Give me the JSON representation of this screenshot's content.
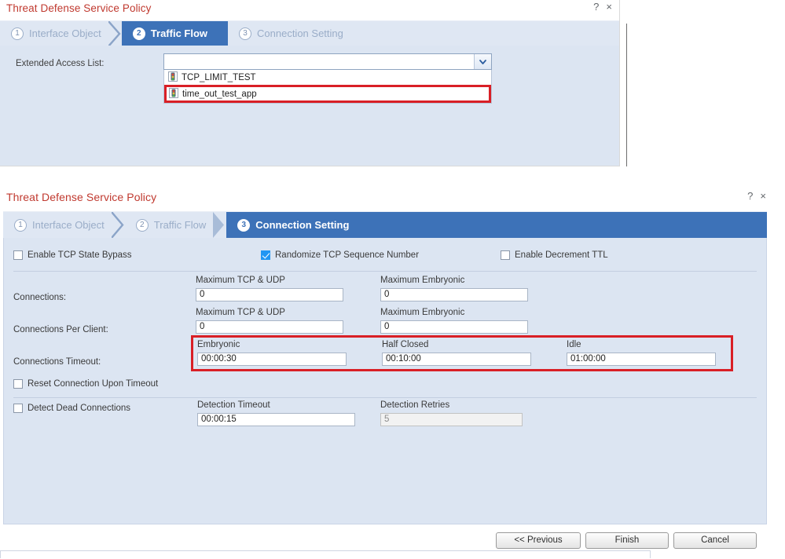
{
  "colors": {
    "title_red": "#c0392f",
    "step_active_blue": "#3d72b8",
    "step_inactive_bg": "#dfe7f3",
    "body_blue": "#dce5f2",
    "highlight_red": "#d91f26",
    "checkbox_checked_blue": "#2196f3"
  },
  "traffic_flow_dialog": {
    "title": "Threat Defense Service Policy",
    "help_icon": "question-mark-icon",
    "help_label": "?",
    "close_icon": "close-icon",
    "close_label": "×",
    "steps": [
      {
        "number": "1",
        "label": "Interface Object",
        "active": false
      },
      {
        "number": "2",
        "label": "Traffic Flow",
        "active": true
      },
      {
        "number": "3",
        "label": "Connection Setting",
        "active": false
      }
    ],
    "access_list": {
      "label": "Extended Access List:",
      "value": "",
      "placeholder": "",
      "dropdown_icon": "chevron-down-icon",
      "options": [
        {
          "label": "TCP_LIMIT_TEST",
          "icon": "acl-traffic-light-icon",
          "highlighted": false
        },
        {
          "label": "time_out_test_app",
          "icon": "acl-traffic-light-icon",
          "highlighted": true
        }
      ]
    }
  },
  "connection_setting_dialog": {
    "title": "Threat Defense Service Policy",
    "help_label": "?",
    "close_label": "×",
    "steps": [
      {
        "number": "1",
        "label": "Interface Object",
        "active": false
      },
      {
        "number": "2",
        "label": "Traffic Flow",
        "active": false
      },
      {
        "number": "3",
        "label": "Connection Setting",
        "active": true
      }
    ],
    "top_checkboxes": [
      {
        "label": "Enable TCP State Bypass",
        "checked": false
      },
      {
        "label": "Randomize TCP Sequence Number",
        "checked": true
      },
      {
        "label": "Enable Decrement TTL",
        "checked": false
      }
    ],
    "connections": {
      "row_label": "Connections:",
      "max_tcp_udp_label": "Maximum TCP & UDP",
      "max_tcp_udp_value": "0",
      "max_embryonic_label": "Maximum Embryonic",
      "max_embryonic_value": "0"
    },
    "connections_per_client": {
      "row_label": "Connections Per Client:",
      "max_tcp_udp_label": "Maximum TCP & UDP",
      "max_tcp_udp_value": "0",
      "max_embryonic_label": "Maximum Embryonic",
      "max_embryonic_value": "0"
    },
    "connections_timeout": {
      "row_label": "Connections Timeout:",
      "embryonic_label": "Embryonic",
      "embryonic_value": "00:00:30",
      "half_closed_label": "Half Closed",
      "half_closed_value": "00:10:00",
      "idle_label": "Idle",
      "idle_value": "01:00:00",
      "highlighted": true
    },
    "reset_connection": {
      "label": "Reset Connection Upon Timeout",
      "checked": false
    },
    "detect_dead_connections": {
      "label": "Detect Dead Connections",
      "checked": false,
      "detection_timeout_label": "Detection Timeout",
      "detection_timeout_value": "00:00:15",
      "detection_retries_label": "Detection Retries",
      "detection_retries_value": "5",
      "detection_retries_disabled": true
    },
    "footer_buttons": [
      {
        "label": "<< Previous",
        "name": "previous-button"
      },
      {
        "label": "Finish",
        "name": "finish-button"
      },
      {
        "label": "Cancel",
        "name": "cancel-button"
      }
    ]
  }
}
